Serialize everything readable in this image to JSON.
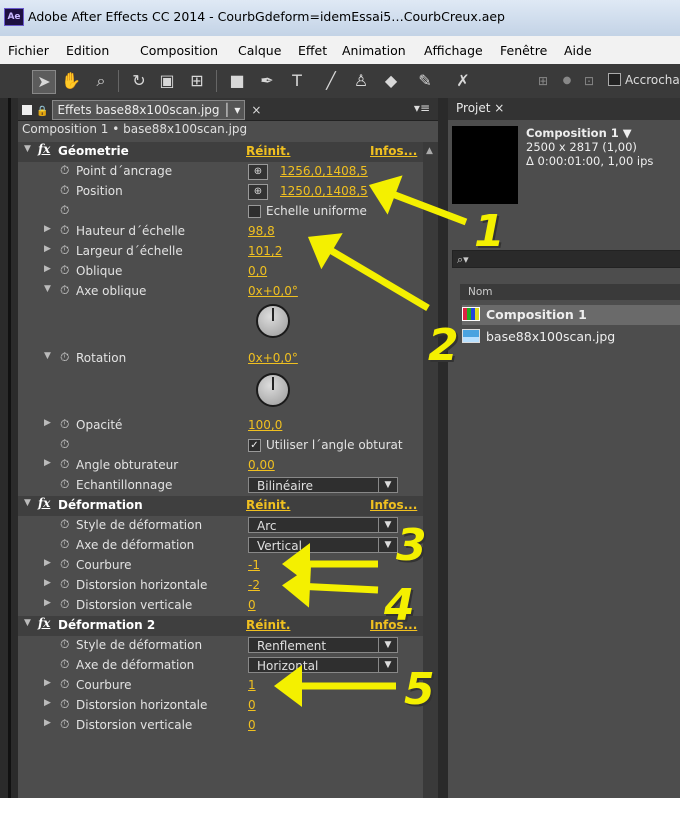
{
  "window": {
    "logo": "Ae",
    "title": "Adobe After Effects CC 2014 - CourbGdeform=idemEssai5…CourbCreux.aep"
  },
  "menu": [
    "Fichier",
    "Edition",
    "Composition",
    "Calque",
    "Effet",
    "Animation",
    "Affichage",
    "Fenêtre",
    "Aide"
  ],
  "toolbar": {
    "tools": [
      "selection-tool",
      "hand-tool",
      "zoom-tool",
      "rotate-tool",
      "camera-tool",
      "pan-behind-tool",
      "rectangle-tool",
      "pen-tool",
      "text-tool",
      "brush-tool",
      "clone-stamp-tool",
      "eraser-tool",
      "roto-brush-tool",
      "puppet-pin-tool"
    ],
    "snap_label": "Accrocha"
  },
  "effects_panel": {
    "tab_label": "Effets base88x100scan.jpg",
    "breadcrumb": "Composition 1 • base88x100scan.jpg",
    "reset": "Réinit.",
    "infos": "Infos...",
    "geometrie": {
      "name": "Géometrie",
      "anchor_label": "Point d´ancrage",
      "anchor_value": "1256,0,1408,5",
      "position_label": "Position",
      "position_value": "1250,0,1408,5",
      "uniform_label": "Echelle uniforme",
      "height_label": "Hauteur d´échelle",
      "height_value": "98,8",
      "width_label": "Largeur d´échelle",
      "width_value": "101,2",
      "skew_label": "Oblique",
      "skew_value": "0,0",
      "skew_axis_label": "Axe oblique",
      "skew_axis_value": "0x+0,0°",
      "rotation_label": "Rotation",
      "rotation_value": "0x+0,0°",
      "opacity_label": "Opacité",
      "opacity_value": "100,0",
      "shutter_check_label": "Utiliser l´angle obturat",
      "shutter_label": "Angle obturateur",
      "shutter_value": "0,00",
      "sampling_label": "Echantillonnage",
      "sampling_value": "Bilinéaire"
    },
    "deformation": {
      "name": "Déformation",
      "style_label": "Style de déformation",
      "style_value": "Arc",
      "axis_label": "Axe de déformation",
      "axis_value": "Vertical",
      "bend_label": "Courbure",
      "bend_value": "-1",
      "hdist_label": "Distorsion horizontale",
      "hdist_value": "-2",
      "vdist_label": "Distorsion verticale",
      "vdist_value": "0"
    },
    "deformation2": {
      "name": "Déformation 2",
      "style_label": "Style de déformation",
      "style_value": "Renflement",
      "axis_label": "Axe de déformation",
      "axis_value": "Horizontal",
      "bend_label": "Courbure",
      "bend_value": "1",
      "hdist_label": "Distorsion horizontale",
      "hdist_value": "0",
      "vdist_label": "Distorsion verticale",
      "vdist_value": "0"
    }
  },
  "project_panel": {
    "tab_label": "Projet",
    "comp_name": "Composition 1 ▼",
    "comp_size": "2500 x 2817 (1,00)",
    "comp_duration": "Δ 0:00:01:00, 1,00 ips",
    "search_placeholder": "⌕▾",
    "col_name": "Nom",
    "items": [
      "Composition 1",
      "base88x100scan.jpg"
    ]
  },
  "annotations": [
    "1",
    "2",
    "3",
    "4",
    "5"
  ],
  "colors": {
    "annotation": "#f4f000",
    "value": "#f0c020",
    "panel": "#4d4d4d"
  }
}
